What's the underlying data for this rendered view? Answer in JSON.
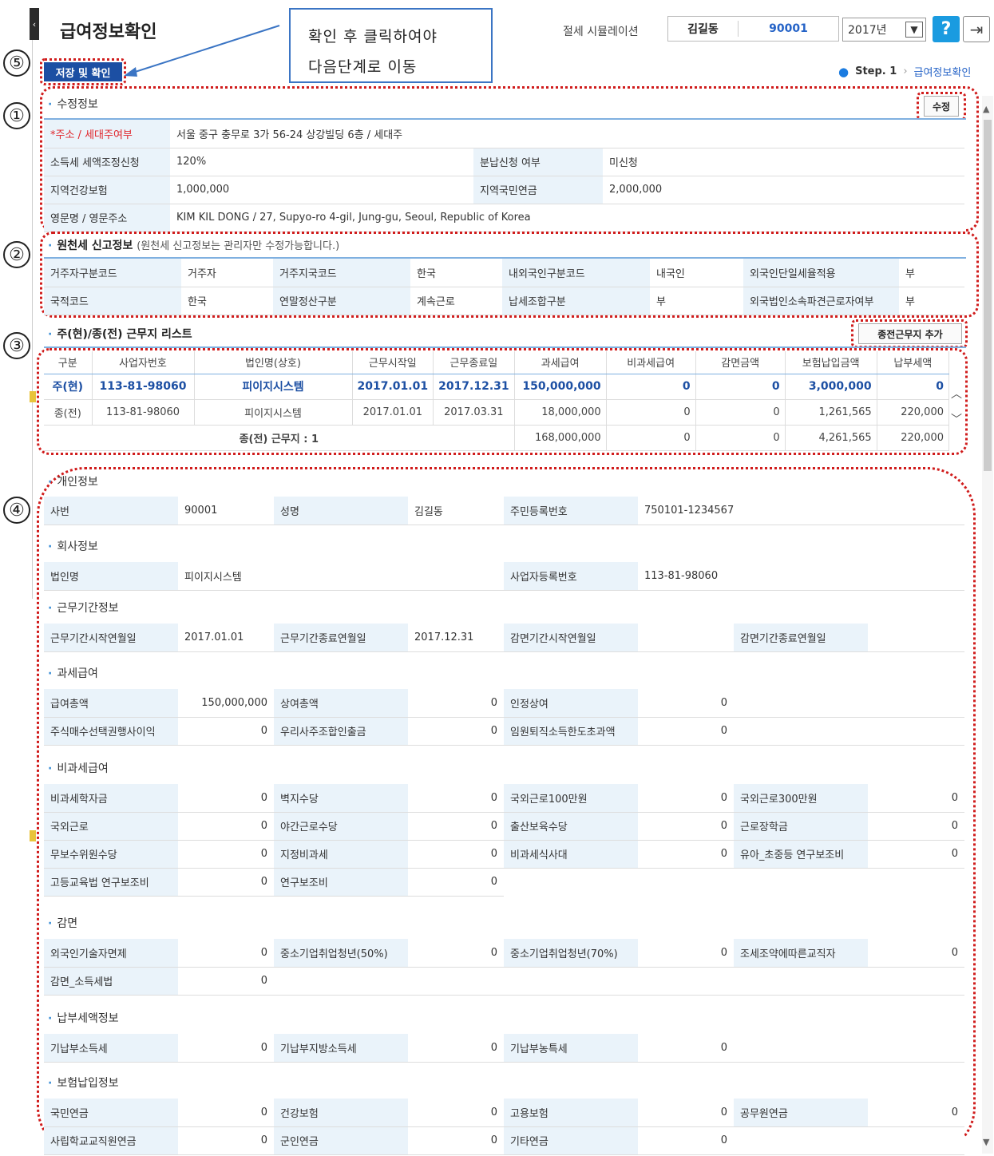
{
  "header": {
    "title": "급여정보확인",
    "sim_label": "절세 시뮬레이션",
    "user_name": "김길동",
    "user_id": "90001",
    "year": "2017년",
    "help": "?",
    "collapse": "‹"
  },
  "callout": {
    "line1": "확인  후  클릭하여야",
    "line2": "다음단계로 이동"
  },
  "save_button": "저장 및 확인",
  "breadcrumb": {
    "step": "Step. 1",
    "current": "급여정보확인"
  },
  "markers": [
    "①",
    "②",
    "③",
    "④",
    "⑤"
  ],
  "edit_info": {
    "title": "수정정보",
    "edit_button": "수정",
    "address_label": "주소 / 세대주여부",
    "address_value": "서울 중구 충무로 3가 56-24 상강빌딩 6층 / 세대주",
    "rows": [
      {
        "l1": "소득세 세액조정신청",
        "v1": "120%",
        "l2": "분납신청 여부",
        "v2": "미신청"
      },
      {
        "l1": "지역건강보험",
        "v1": "1,000,000",
        "l2": "지역국민연금",
        "v2": "2,000,000"
      }
    ],
    "eng_label": "영문명 / 영문주소",
    "eng_value": "KIM KIL DONG / 27, Supyo-ro 4-gil, Jung-gu, Seoul, Republic of Korea"
  },
  "withholding": {
    "title": "원천세 신고정보",
    "note": "(원천세 신고정보는 관리자만 수정가능합니다.)",
    "row1": [
      "거주자구분코드",
      "거주자",
      "거주지국코드",
      "한국",
      "내외국인구분코드",
      "내국인",
      "외국인단일세율적용",
      "부"
    ],
    "row2": [
      "국적코드",
      "한국",
      "연말정산구분",
      "계속근로",
      "납세조합구분",
      "부",
      "외국법인소속파견근로자여부",
      "부"
    ]
  },
  "workplace": {
    "title": "주(현)/종(전) 근무지 리스트",
    "add_button": "종전근무지 추가",
    "headers": [
      "구분",
      "사업자번호",
      "법인명(상호)",
      "근무시작일",
      "근무종료일",
      "과세급여",
      "비과세급여",
      "감면금액",
      "보험납입금액",
      "납부세액"
    ],
    "rows": [
      [
        "주(현)",
        "113-81-98060",
        "피이지시스템",
        "2017.01.01",
        "2017.12.31",
        "150,000,000",
        "0",
        "0",
        "3,000,000",
        "0"
      ],
      [
        "종(전)",
        "113-81-98060",
        "피이지시스템",
        "2017.01.01",
        "2017.03.31",
        "18,000,000",
        "0",
        "0",
        "1,261,565",
        "220,000"
      ]
    ],
    "sum_label": "종(전) 근무지 : 1",
    "sum": [
      "168,000,000",
      "0",
      "0",
      "4,261,565",
      "220,000"
    ]
  },
  "personal": {
    "title": "개인정보",
    "row": [
      "사번",
      "90001",
      "성명",
      "김길동",
      "주민등록번호",
      "750101-1234567"
    ]
  },
  "company": {
    "title": "회사정보",
    "row": [
      "법인명",
      "피이지시스템",
      "사업자등록번호",
      "113-81-98060"
    ]
  },
  "period": {
    "title": "근무기간정보",
    "row": [
      "근무기간시작연월일",
      "2017.01.01",
      "근무기간종료연월일",
      "2017.12.31",
      "감면기간시작연월일",
      "",
      "감면기간종료연월일",
      ""
    ]
  },
  "taxable": {
    "title": "과세급여",
    "rows": [
      [
        "급여총액",
        "150,000,000",
        "상여총액",
        "0",
        "인정상여",
        "0"
      ],
      [
        "주식매수선택권행사이익",
        "0",
        "우리사주조합인출금",
        "0",
        "임원퇴직소득한도초과액",
        "0"
      ]
    ]
  },
  "nontaxable": {
    "title": "비과세급여",
    "rows": [
      [
        "비과세학자금",
        "0",
        "벽지수당",
        "0",
        "국외근로100만원",
        "0",
        "국외근로300만원",
        "0"
      ],
      [
        "국외근로",
        "0",
        "야간근로수당",
        "0",
        "출산보육수당",
        "0",
        "근로장학금",
        "0"
      ],
      [
        "무보수위원수당",
        "0",
        "지정비과세",
        "0",
        "비과세식사대",
        "0",
        "유아_초중등 연구보조비",
        "0"
      ],
      [
        "고등교육법 연구보조비",
        "0",
        "연구보조비",
        "0"
      ]
    ]
  },
  "reduction": {
    "title": "감면",
    "rows": [
      [
        "외국인기술자면제",
        "0",
        "중소기업취업청년(50%)",
        "0",
        "중소기업취업청년(70%)",
        "0",
        "조세조약에따른교직자",
        "0"
      ],
      [
        "감면_소득세법",
        "0"
      ]
    ]
  },
  "paid_tax": {
    "title": "납부세액정보",
    "rows": [
      [
        "기납부소득세",
        "0",
        "기납부지방소득세",
        "0",
        "기납부농특세",
        "0"
      ]
    ]
  },
  "insurance": {
    "title": "보험납입정보",
    "rows": [
      [
        "국민연금",
        "0",
        "건강보험",
        "0",
        "고용보험",
        "0",
        "공무원연금",
        "0"
      ],
      [
        "사립학교교직원연금",
        "0",
        "군인연금",
        "0",
        "기타연금",
        "0"
      ]
    ]
  },
  "colors": {
    "accent": "#1c4fa3",
    "label_bg": "#eaf3fa",
    "highlight": "#d01c1c",
    "help": "#1a9be0"
  }
}
